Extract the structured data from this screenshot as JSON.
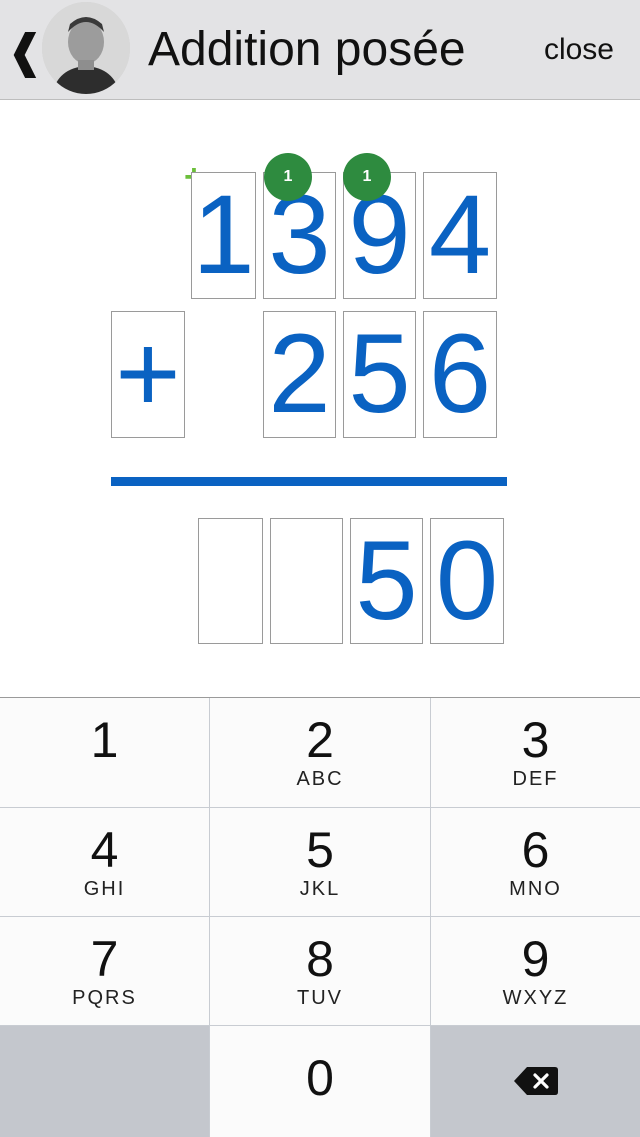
{
  "header": {
    "back_label": "❰",
    "title": "Addition posée",
    "close_label": "close"
  },
  "addition": {
    "plus_sign_marker": "+",
    "top_number": {
      "digits": [
        "1",
        "3",
        "9",
        "4"
      ]
    },
    "carries": [
      "1",
      "1"
    ],
    "operator": "+",
    "bottom_number": {
      "digits": [
        "2",
        "5",
        "6"
      ]
    },
    "result": {
      "digits": [
        "",
        "",
        "5",
        "0"
      ]
    },
    "accent_color": "#0a62c2",
    "carry_color": "#2e8b3f"
  },
  "keypad": {
    "keys": [
      {
        "num": "1",
        "letters": ""
      },
      {
        "num": "2",
        "letters": "ABC"
      },
      {
        "num": "3",
        "letters": "DEF"
      },
      {
        "num": "4",
        "letters": "GHI"
      },
      {
        "num": "5",
        "letters": "JKL"
      },
      {
        "num": "6",
        "letters": "MNO"
      },
      {
        "num": "7",
        "letters": "PQRS"
      },
      {
        "num": "8",
        "letters": "TUV"
      },
      {
        "num": "9",
        "letters": "WXYZ"
      },
      {
        "num": "0",
        "letters": ""
      }
    ],
    "delete_icon": "backspace-icon"
  }
}
